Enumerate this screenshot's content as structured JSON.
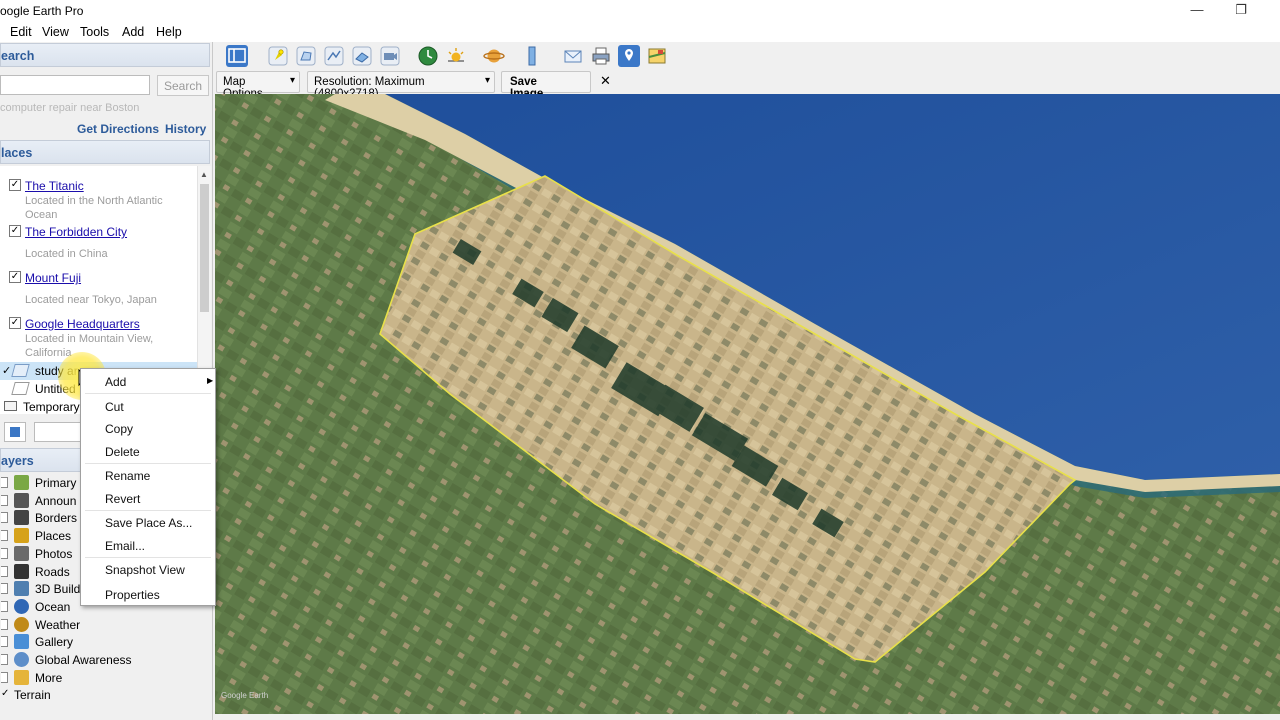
{
  "window": {
    "title": "oogle Earth Pro",
    "minimize": "—",
    "restore": "❐"
  },
  "menu": [
    "Edit",
    "View",
    "Tools",
    "Add",
    "Help"
  ],
  "toolbar": {
    "map_options": "Map Options",
    "resolution": "Resolution: Maximum (4800x2718)",
    "save_image": "Save Image...",
    "close": "✕"
  },
  "search": {
    "header": "earch",
    "button": "Search",
    "hint": "computer repair near Boston",
    "get_directions": "Get Directions",
    "history": "History"
  },
  "places": {
    "header": "laces",
    "items": [
      {
        "title": "The Titanic",
        "desc": "Located in the North Atlantic Ocean"
      },
      {
        "title": "The Forbidden City",
        "desc": "Located in China"
      },
      {
        "title": "Mount Fuji",
        "desc": "Located near Tokyo, Japan"
      },
      {
        "title": "Google Headquarters",
        "desc": "Located in Mountain View, California"
      }
    ],
    "tree": [
      {
        "label": "study ar",
        "selected": true
      },
      {
        "label": "Untitled"
      },
      {
        "label": "Temporary"
      }
    ]
  },
  "layers": {
    "header": "ayers",
    "items": [
      {
        "label": "Primary Da",
        "icon": "layers-icon",
        "color": "#7aa845"
      },
      {
        "label": "Announ",
        "icon": "envelope-icon",
        "color": "#555555"
      },
      {
        "label": "Borders",
        "icon": "flag-icon",
        "color": "#444444"
      },
      {
        "label": "Places",
        "icon": "places-icon",
        "color": "#d6a21a"
      },
      {
        "label": "Photos",
        "icon": "photo-icon",
        "color": "#6a6a6a"
      },
      {
        "label": "Roads",
        "icon": "road-icon",
        "color": "#333333"
      },
      {
        "label": "3D Build",
        "icon": "building-icon",
        "color": "#4f7fb0"
      },
      {
        "label": "Ocean",
        "icon": "ocean-icon",
        "color": "#2f67b5"
      },
      {
        "label": "Weather",
        "icon": "sun-icon",
        "color": "#c08a18"
      },
      {
        "label": "Gallery",
        "icon": "gallery-icon",
        "color": "#4a8fd6"
      },
      {
        "label": "Global Awareness",
        "icon": "globe-icon",
        "color": "#5d8ec9"
      },
      {
        "label": "More",
        "icon": "more-icon",
        "color": "#e5b43a"
      },
      {
        "label": "Terrain",
        "icon": "",
        "color": ""
      }
    ]
  },
  "context_menu": {
    "items": [
      "Add",
      "Cut",
      "Copy",
      "Delete",
      "Rename",
      "Revert",
      "Save Place As...",
      "Email...",
      "Snapshot View",
      "Properties"
    ],
    "submenu_arrow": "▶"
  },
  "map": {
    "watermark": "Google Earth",
    "polygon_color": "#e8e04a"
  }
}
